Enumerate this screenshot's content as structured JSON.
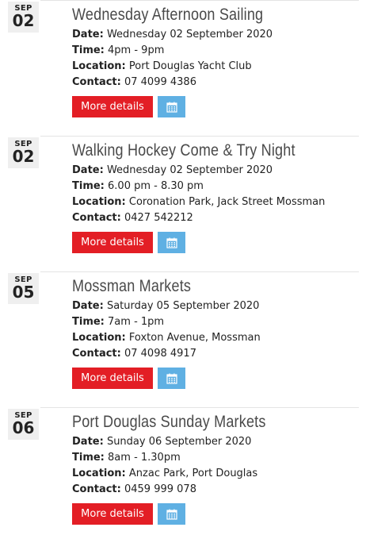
{
  "labels": {
    "date": "Date:",
    "time": "Time:",
    "location": "Location:",
    "contact": "Contact:",
    "more": "More details"
  },
  "icons": {
    "calendar": "calendar-icon"
  },
  "colors": {
    "more_button": "#e31e25",
    "calendar_button": "#5fb0e3",
    "date_box": "#efefef"
  },
  "events": [
    {
      "month": "SEP",
      "day": "02",
      "title": "Wednesday Afternoon Sailing",
      "date": "Wednesday 02 September 2020",
      "time": "4pm - 9pm",
      "location": "Port Douglas Yacht Club",
      "contact": "07 4099 4386"
    },
    {
      "month": "SEP",
      "day": "02",
      "title": "Walking Hockey Come & Try Night",
      "date": "Wednesday 02 September 2020",
      "time": "6.00 pm - 8.30 pm",
      "location": "Coronation Park, Jack Street Mossman",
      "contact": "0427 542212"
    },
    {
      "month": "SEP",
      "day": "05",
      "title": "Mossman Markets",
      "date": "Saturday 05 September 2020",
      "time": "7am - 1pm",
      "location": "Foxton Avenue, Mossman",
      "contact": "07 4098 4917"
    },
    {
      "month": "SEP",
      "day": "06",
      "title": "Port Douglas Sunday Markets",
      "date": "Sunday 06 September 2020",
      "time": "8am - 1.30pm",
      "location": "Anzac Park, Port Douglas",
      "contact": "0459 999 078"
    }
  ]
}
